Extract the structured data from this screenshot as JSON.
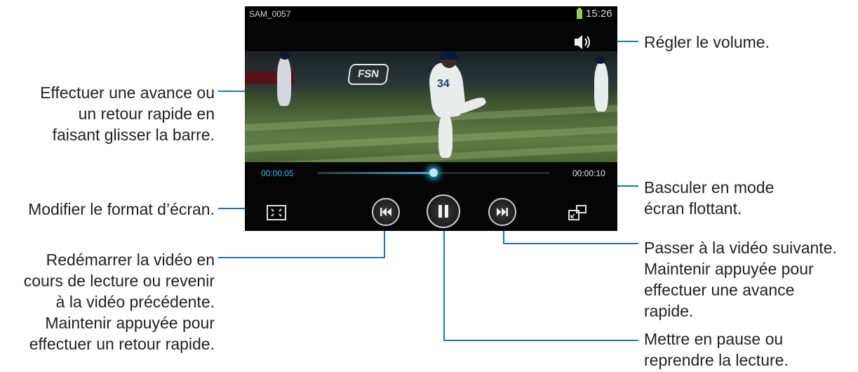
{
  "screen": {
    "status_bar": {
      "file_name": "SAM_0057",
      "clock": "15:26"
    },
    "video": {
      "sign_text": "FSN",
      "jersey_number": "34"
    },
    "player": {
      "time_current": "00:00:05",
      "time_total": "00:00:10",
      "progress_fraction": 0.5
    }
  },
  "annotations": {
    "scrub_line1": "Effectuer une avance ou",
    "scrub_line2": "un retour rapide en",
    "scrub_line3": "faisant glisser la barre.",
    "aspect": "Modifier le format d’écran.",
    "prev_line1": "Redémarrer la vidéo en",
    "prev_line2": "cours de lecture ou revenir",
    "prev_line3": "à la vidéo précédente.",
    "prev_line4": "Maintenir appuyée pour",
    "prev_line5": "effectuer un retour rapide.",
    "volume": "Régler le volume.",
    "float_line1": "Basculer en mode",
    "float_line2": "écran flottant.",
    "next_line1": "Passer à la vidéo suivante.",
    "next_line2": "Maintenir appuyée pour",
    "next_line3": "effectuer une avance",
    "next_line4": "rapide.",
    "pause_line1": "Mettre en pause ou",
    "pause_line2": "reprendre la lecture."
  },
  "colors": {
    "accent": "#33b5e5",
    "leader_line": "#1a78b4",
    "battery": "#8fd14f"
  },
  "icons": [
    "volume-icon",
    "aspect-ratio-icon",
    "previous-icon",
    "pause-icon",
    "next-icon",
    "pop-up-play-icon"
  ]
}
